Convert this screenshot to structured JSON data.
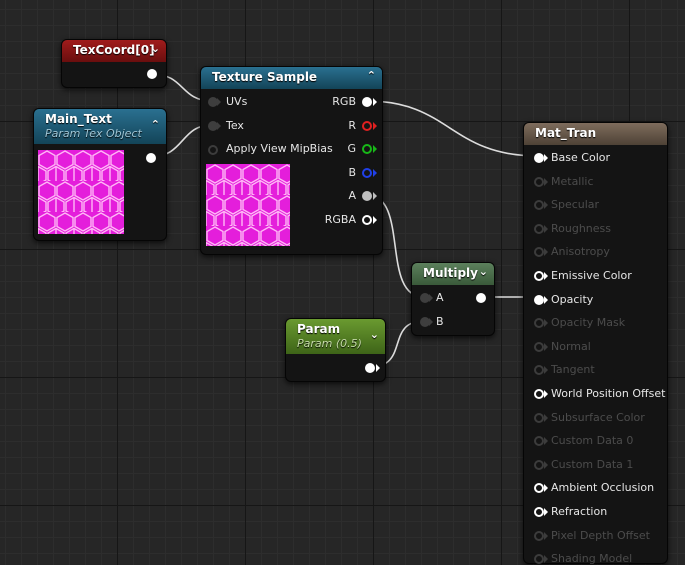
{
  "texcoord": {
    "title": "TexCoord[0]"
  },
  "main_text": {
    "title": "Main_Text",
    "subtitle": "Param Tex Object"
  },
  "texture_sample": {
    "title": "Texture Sample",
    "inputs": [
      "UVs",
      "Tex",
      "Apply View MipBias"
    ],
    "outputs": [
      "RGB",
      "R",
      "G",
      "B",
      "A",
      "RGBA"
    ]
  },
  "multiply": {
    "title": "Multiply",
    "inputs": [
      "A",
      "B"
    ]
  },
  "param": {
    "title": "Param",
    "subtitle": "Param (0.5)"
  },
  "material": {
    "title": "Mat_Tran",
    "pins": [
      {
        "label": "Base Color",
        "state": "connected"
      },
      {
        "label": "Metallic",
        "state": "disabled"
      },
      {
        "label": "Specular",
        "state": "disabled"
      },
      {
        "label": "Roughness",
        "state": "disabled"
      },
      {
        "label": "Anisotropy",
        "state": "disabled"
      },
      {
        "label": "Emissive Color",
        "state": "enabled"
      },
      {
        "label": "Opacity",
        "state": "connected"
      },
      {
        "label": "Opacity Mask",
        "state": "disabled"
      },
      {
        "label": "Normal",
        "state": "disabled"
      },
      {
        "label": "Tangent",
        "state": "disabled"
      },
      {
        "label": "World Position Offset",
        "state": "enabled"
      },
      {
        "label": "Subsurface Color",
        "state": "disabled"
      },
      {
        "label": "Custom Data 0",
        "state": "disabled"
      },
      {
        "label": "Custom Data 1",
        "state": "disabled"
      },
      {
        "label": "Ambient Occlusion",
        "state": "enabled"
      },
      {
        "label": "Refraction",
        "state": "enabled"
      },
      {
        "label": "Pixel Depth Offset",
        "state": "disabled"
      },
      {
        "label": "Shading Model",
        "state": "disabled"
      }
    ]
  },
  "colors": {
    "texcoord_header": "#8a1414",
    "texture_header": "#1c5a76",
    "multiply_header": "#4a6e4a",
    "param_header": "#5c8a2a",
    "material_header": "#6e5e4e",
    "hex_fill": "#e41edb",
    "pin_r": "#e02020",
    "pin_g": "#18b818",
    "pin_b": "#2040e8"
  }
}
